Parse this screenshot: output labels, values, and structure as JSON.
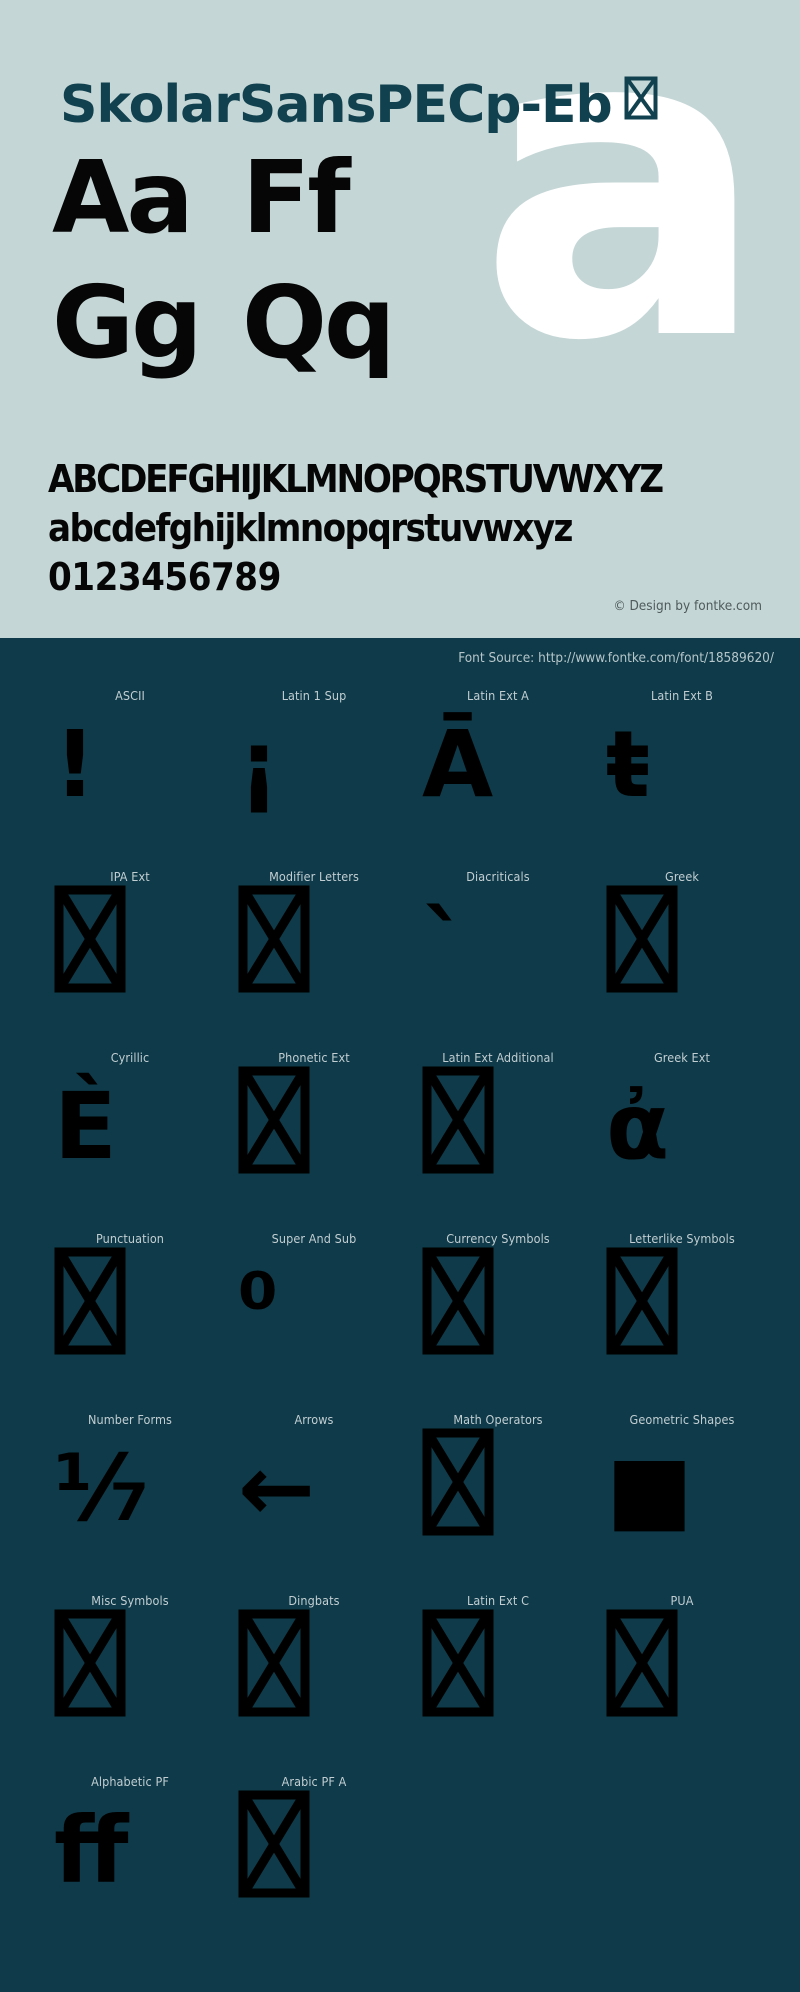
{
  "colors": {
    "light_bg": "#c5d6d6",
    "dark_bg": "#0e3a49",
    "title": "#11414f",
    "glyph": "#000000",
    "watermark": "#ffffff",
    "label": "#c2ced2",
    "credit": "#4e5a5c"
  },
  "specimen": {
    "title": "SkolarSansPECp-Eb",
    "title_missing_glyph": "⌧",
    "watermark_letter": "a",
    "pairs": [
      [
        "Aa",
        "Ff"
      ],
      [
        "Gg",
        "Qq"
      ]
    ],
    "alphabet_upper": "ABCDEFGHIJKLMNOPQRSTUVWXYZ",
    "alphabet_lower": "abcdefghijklmnopqrstuvwxyz",
    "digits": "0123456789",
    "design_credit": "© Design by fontke.com"
  },
  "glyphmap": {
    "font_source": "Font Source: http://www.fontke.com/font/18589620/",
    "rows": [
      [
        {
          "label": "ASCII",
          "sample": "!",
          "missing": false
        },
        {
          "label": "Latin 1 Sup",
          "sample": "¡",
          "missing": false
        },
        {
          "label": "Latin Ext A",
          "sample": "Ā",
          "missing": false
        },
        {
          "label": "Latin Ext B",
          "sample": "ŧ",
          "missing": false
        }
      ],
      [
        {
          "label": "IPA Ext",
          "sample": "",
          "missing": true
        },
        {
          "label": "Modifier Letters",
          "sample": "",
          "missing": true
        },
        {
          "label": "Diacriticals",
          "sample": "ˋ",
          "missing": false
        },
        {
          "label": "Greek",
          "sample": "",
          "missing": true
        }
      ],
      [
        {
          "label": "Cyrillic",
          "sample": "Ѐ",
          "missing": false
        },
        {
          "label": "Phonetic Ext",
          "sample": "",
          "missing": true
        },
        {
          "label": "Latin Ext Additional",
          "sample": "",
          "missing": true
        },
        {
          "label": "Greek Ext",
          "sample": "ἀ",
          "missing": false
        }
      ],
      [
        {
          "label": "Punctuation",
          "sample": "",
          "missing": true
        },
        {
          "label": "Super And Sub",
          "sample": "⁰",
          "missing": false
        },
        {
          "label": "Currency Symbols",
          "sample": "",
          "missing": true
        },
        {
          "label": "Letterlike Symbols",
          "sample": "",
          "missing": true
        }
      ],
      [
        {
          "label": "Number Forms",
          "sample": "⅐",
          "missing": false
        },
        {
          "label": "Arrows",
          "sample": "←",
          "missing": false
        },
        {
          "label": "Math Operators",
          "sample": "",
          "missing": true
        },
        {
          "label": "Geometric Shapes",
          "sample": "■",
          "missing": false
        }
      ],
      [
        {
          "label": "Misc Symbols",
          "sample": "",
          "missing": true
        },
        {
          "label": "Dingbats",
          "sample": "",
          "missing": true
        },
        {
          "label": "Latin Ext C",
          "sample": "",
          "missing": true
        },
        {
          "label": "PUA",
          "sample": "",
          "missing": true
        }
      ],
      [
        {
          "label": "Alphabetic PF",
          "sample": "ﬀ",
          "missing": false
        },
        {
          "label": "Arabic PF A",
          "sample": "",
          "missing": true
        },
        {
          "label": "",
          "sample": "",
          "missing": false
        },
        {
          "label": "",
          "sample": "",
          "missing": false
        }
      ]
    ]
  }
}
